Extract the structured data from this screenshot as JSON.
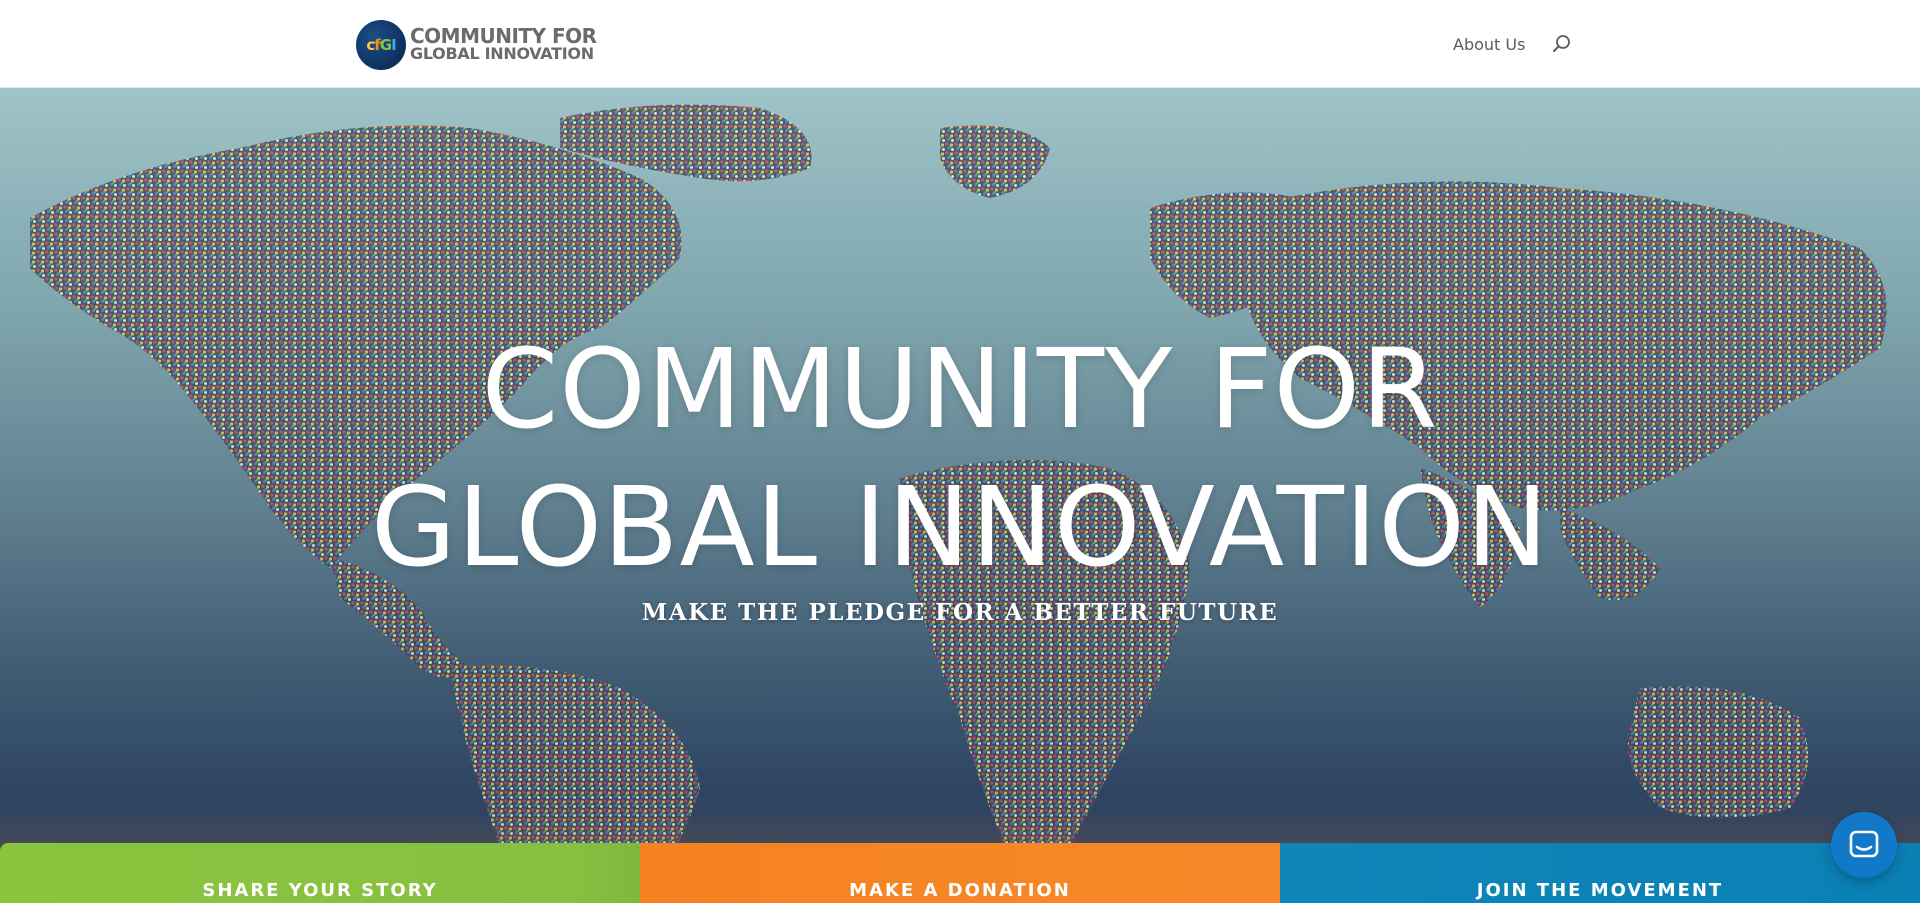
{
  "header": {
    "logo": {
      "mark_letters": [
        "c",
        "f",
        "G",
        "I"
      ],
      "line1": "COMMUNITY FOR",
      "line2": "GLOBAL INNOVATION"
    },
    "nav": {
      "about_label": "About Us",
      "search_icon": "search-icon"
    }
  },
  "hero": {
    "title_line1": "COMMUNITY FOR",
    "title_line2": "GLOBAL INNOVATION",
    "subtitle": "MAKE THE PLEDGE FOR A BETTER FUTURE"
  },
  "cta": {
    "share_label": "SHARE YOUR STORY",
    "donate_label": "MAKE A DONATION",
    "join_label": "JOIN THE MOVEMENT"
  },
  "chat": {
    "icon": "chat-icon"
  },
  "colors": {
    "green": "#8bc53f",
    "orange": "#f5821f",
    "blue": "#0e86b8",
    "logo_navy": "#0e2f5e",
    "chat_blue": "#1279c9"
  }
}
